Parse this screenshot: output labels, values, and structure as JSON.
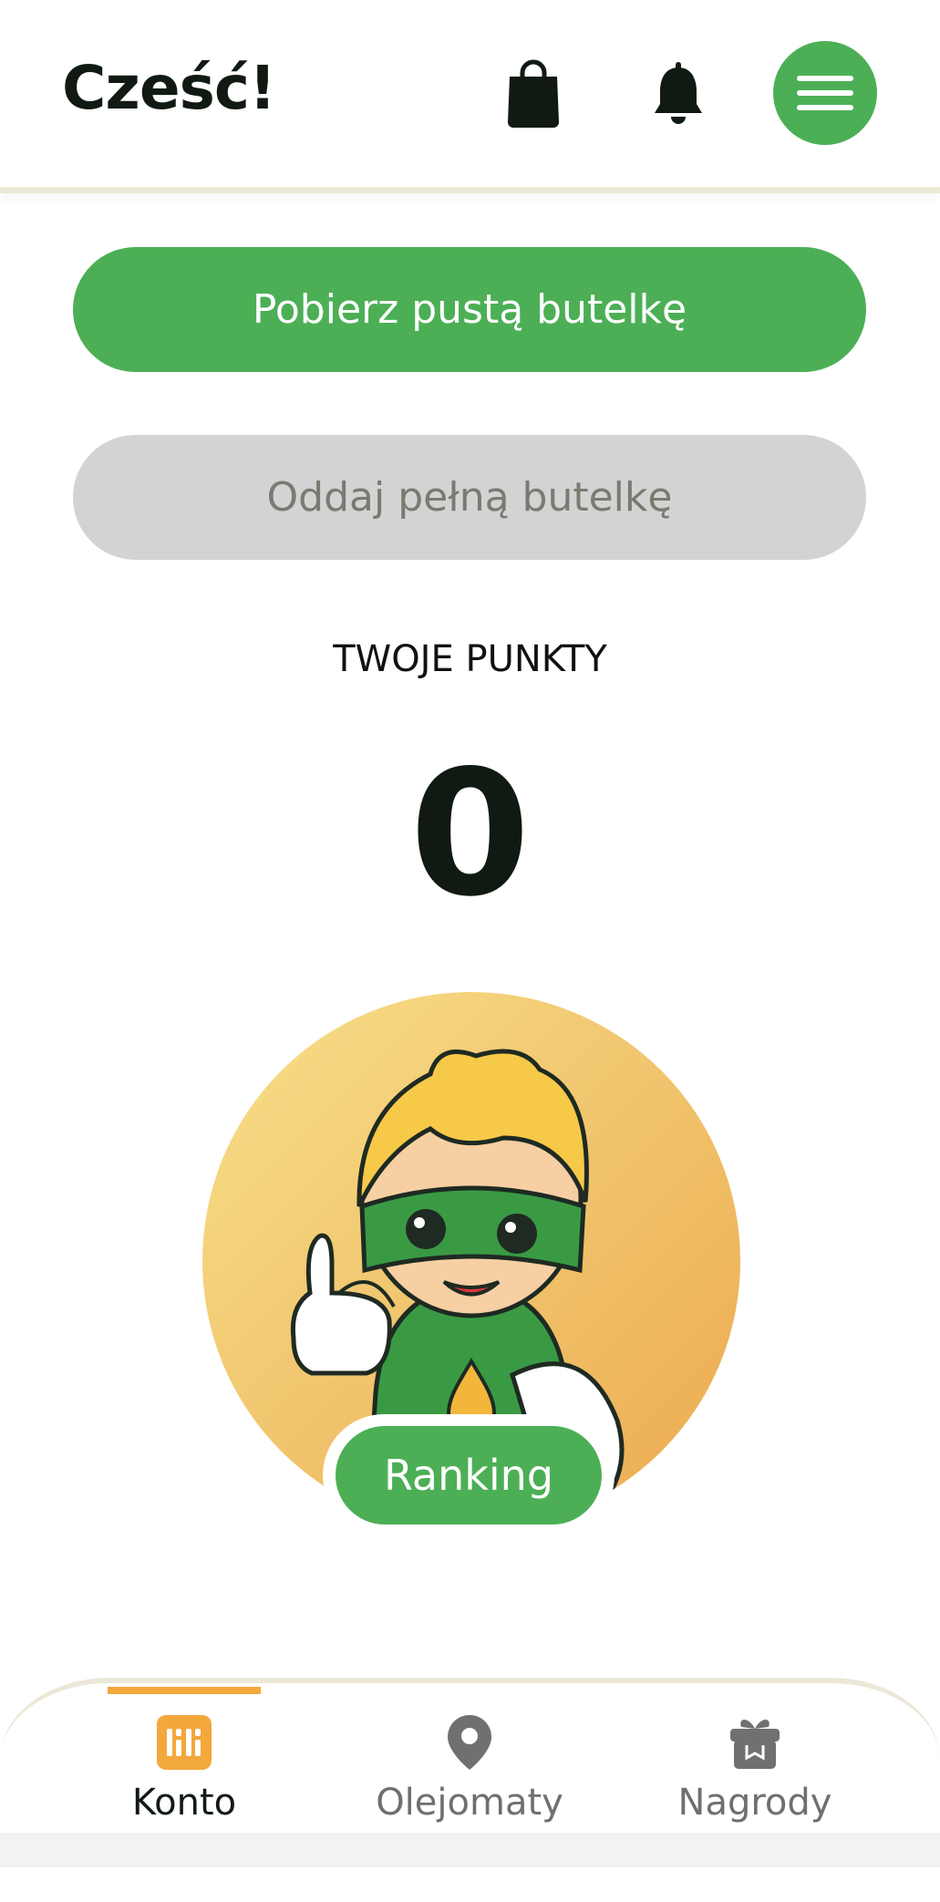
{
  "header": {
    "greeting": "Cześć!",
    "icons": [
      "shopping-bag-icon",
      "bell-icon",
      "menu-icon"
    ]
  },
  "actions": {
    "primary_label": "Pobierz pustą butelkę",
    "secondary_label": "Oddaj pełną butelkę"
  },
  "points": {
    "label": "TWOJE PUNKTY",
    "value": "0"
  },
  "ranking": {
    "label": "Ranking"
  },
  "bottom_nav": {
    "items": [
      {
        "label": "Konto",
        "icon": "account-icon",
        "active": true
      },
      {
        "label": "Olejomaty",
        "icon": "location-pin-icon",
        "active": false
      },
      {
        "label": "Nagrody",
        "icon": "gift-icon",
        "active": false
      }
    ]
  },
  "colors": {
    "brand_green": "#4caf55",
    "accent_orange": "#f3a83c",
    "disabled_gray": "#d3d3d3"
  }
}
